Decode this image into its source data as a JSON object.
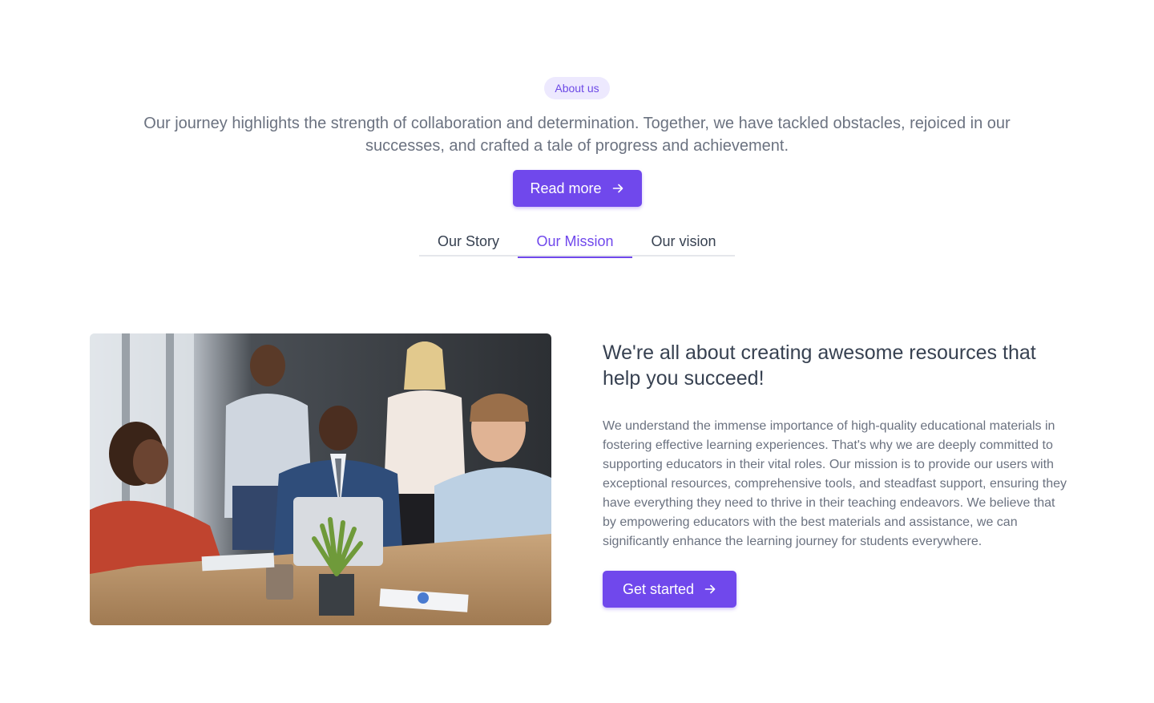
{
  "hero": {
    "badge": "About us",
    "intro": "Our journey highlights the strength of collaboration and determination. Together, we have tackled obstacles, rejoiced in our successes, and crafted a tale of progress and achievement.",
    "read_more_label": "Read more"
  },
  "tabs": [
    {
      "label": "Our Story",
      "active": false
    },
    {
      "label": "Our Mission",
      "active": true
    },
    {
      "label": "Our vision",
      "active": false
    }
  ],
  "mission": {
    "heading": "We're all about creating awesome resources that help you succeed!",
    "body": "We understand the immense importance of high-quality educational materials in fostering effective learning experiences. That's why we are deeply committed to supporting educators in their vital roles. Our mission is to provide our users with exceptional resources, comprehensive tools, and steadfast support, ensuring they have everything they need to thrive in their teaching endeavors. We believe that by empowering educators with the best materials and assistance, we can significantly enhance the learning journey for students everywhere.",
    "cta_label": "Get started"
  },
  "colors": {
    "accent": "#7048ec",
    "badge_bg": "#ede9fe",
    "text": "#374151",
    "muted": "#6b7280"
  },
  "icons": {
    "button_arrow": "arrow-right-icon"
  }
}
